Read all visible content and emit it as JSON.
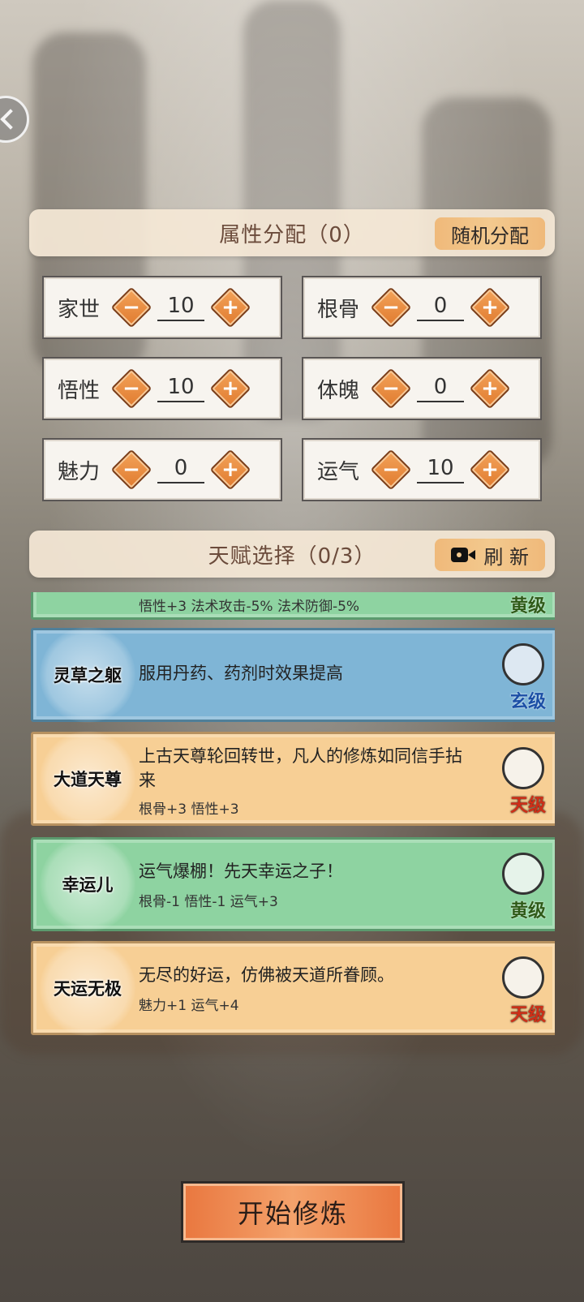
{
  "attributes": {
    "title": "属性分配（0）",
    "random_label": "随机分配",
    "items": [
      {
        "label": "家世",
        "value": "10"
      },
      {
        "label": "根骨",
        "value": "0"
      },
      {
        "label": "悟性",
        "value": "10"
      },
      {
        "label": "体魄",
        "value": "0"
      },
      {
        "label": "魅力",
        "value": "0"
      },
      {
        "label": "运气",
        "value": "10"
      }
    ],
    "minus_symbol": "−",
    "plus_symbol": "+"
  },
  "talents": {
    "title": "天赋选择（0/3）",
    "refresh_label": "刷 新",
    "items": [
      {
        "name": "",
        "desc": "",
        "stats": "悟性+3  法术攻击-5%  法术防御-5%",
        "grade": "黄级",
        "tier": "green"
      },
      {
        "name": "灵草之躯",
        "desc": "服用丹药、药剂时效果提高",
        "stats": "",
        "grade": "玄级",
        "tier": "blue"
      },
      {
        "name": "大道天尊",
        "desc": "上古天尊轮回转世，凡人的修炼如同信手拈来",
        "stats": "根骨+3  悟性+3",
        "grade": "天级",
        "tier": "gold"
      },
      {
        "name": "幸运儿",
        "desc": "运气爆棚！先天幸运之子！",
        "stats": "根骨-1  悟性-1  运气+3",
        "grade": "黄级",
        "tier": "green"
      },
      {
        "name": "天运无极",
        "desc": "无尽的好运，仿佛被天道所眷顾。",
        "stats": "魅力+1  运气+4",
        "grade": "天级",
        "tier": "gold"
      }
    ]
  },
  "start_label": "开始修炼",
  "colors": {
    "accent": "#e9773f",
    "tier_gold": "#f7cf95",
    "tier_green": "#8ed3a1",
    "tier_blue": "#7fb5d6"
  }
}
